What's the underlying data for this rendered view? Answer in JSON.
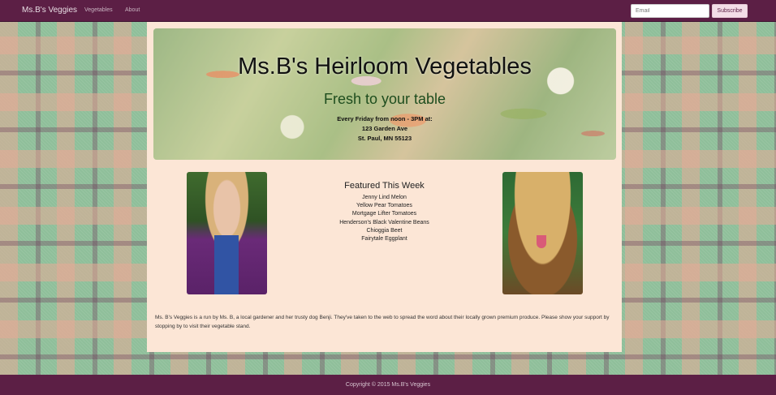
{
  "navbar": {
    "brand": "Ms.B's Veggies",
    "links": [
      "Vegetables",
      "About"
    ],
    "email_placeholder": "Email",
    "subscribe_label": "Subscribe"
  },
  "jumbotron": {
    "title": "Ms.B's Heirloom Vegetables",
    "tagline": "Fresh to your table",
    "schedule": [
      "Every Friday from noon - 3PM at:",
      "123 Garden Ave",
      "St. Paul, MN 55123"
    ]
  },
  "featured": {
    "heading": "Featured This Week",
    "items": [
      "Jenny Lind Melon",
      "Yellow Pear Tomatoes",
      "Mortgage Lifter Tomatoes",
      "Henderson's Black Valentine Beans",
      "Chioggia Beet",
      "Fairytale Eggplant"
    ]
  },
  "about_text": "Ms. B's Veggies is a run by Ms. B, a local gardener and her trusty dog Benji. They've taken to the web to spread the word about their locally grown premium produce. Please show your support by stopping by to visit their vegetable stand.",
  "footer": "Copyright © 2015 Ms.B's Veggies"
}
